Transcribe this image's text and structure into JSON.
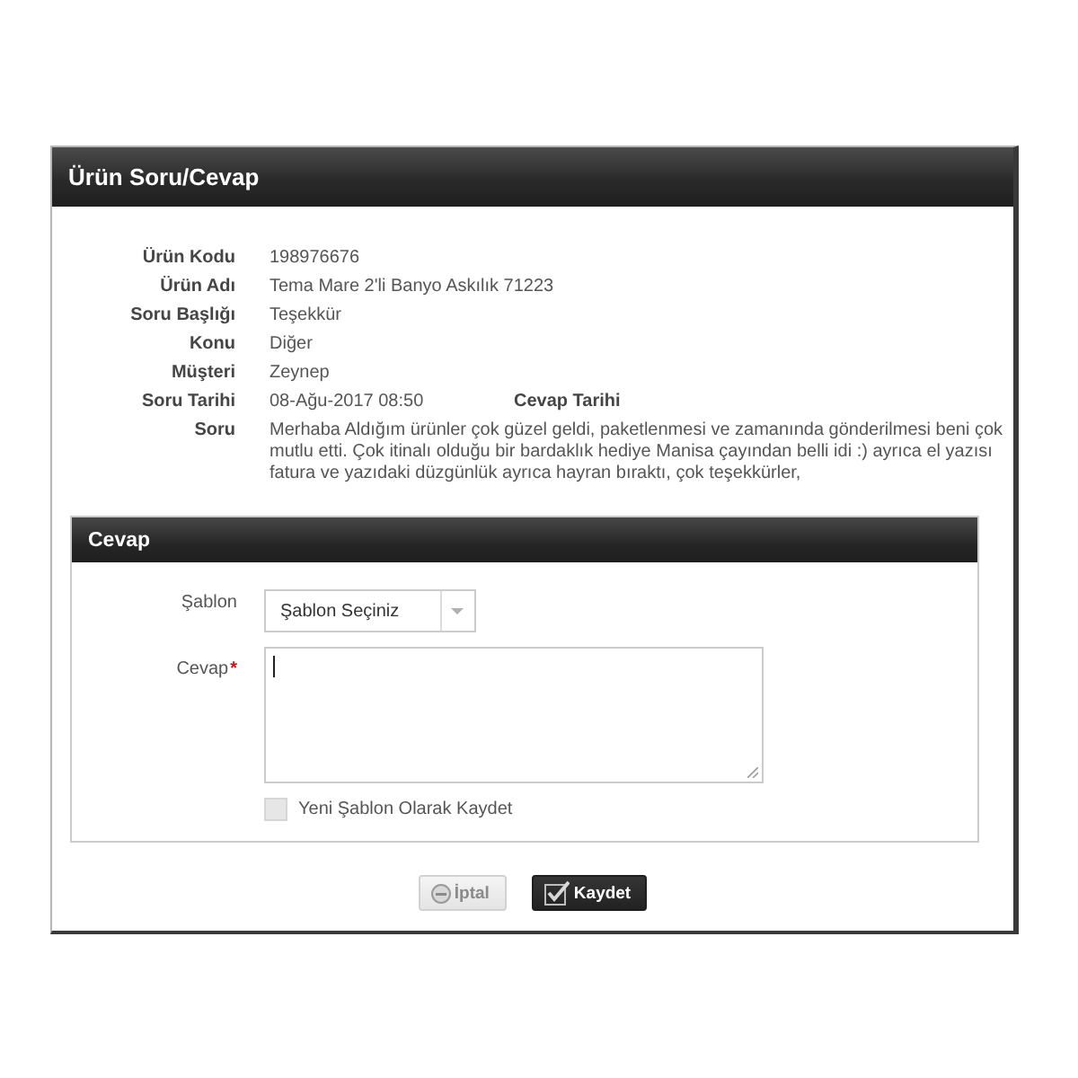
{
  "dialog": {
    "title": "Ürün Soru/Cevap"
  },
  "details": [
    {
      "label": "Ürün Kodu",
      "value": "198976676"
    },
    {
      "label": "Ürün Adı",
      "value": "Tema Mare 2'li Banyo Askılık 71223"
    },
    {
      "label": "Soru Başlığı",
      "value": "Teşekkür"
    },
    {
      "label": "Konu",
      "value": "Diğer"
    },
    {
      "label": "Müşteri",
      "value": "Zeynep"
    },
    {
      "label": "Soru Tarihi",
      "value": "08-Ağu-2017 08:50",
      "extra_label": "Cevap Tarihi"
    },
    {
      "label": "Soru",
      "value": "Merhaba Aldığım ürünler çok güzel geldi, paketlenmesi ve zamanında gönderilmesi beni çok mutlu etti. Çok itinalı olduğu bir bardaklık hediye Manisa çayından belli idi :) ayrıca el yazısı fatura ve yazıdaki düzgünlük ayrıca hayran bıraktı, çok teşekkürler,"
    }
  ],
  "answer_panel": {
    "title": "Cevap",
    "template": {
      "label": "Şablon",
      "value": "Şablon Seçiniz"
    },
    "answer": {
      "label": "Cevap",
      "required_mark": "*",
      "focused": true
    },
    "save_template": {
      "label": "Yeni Şablon Olarak Kaydet",
      "checked": false
    }
  },
  "buttons": [
    {
      "label": "İptal",
      "kind": "cancel"
    },
    {
      "label": "Kaydet",
      "kind": "save"
    }
  ]
}
